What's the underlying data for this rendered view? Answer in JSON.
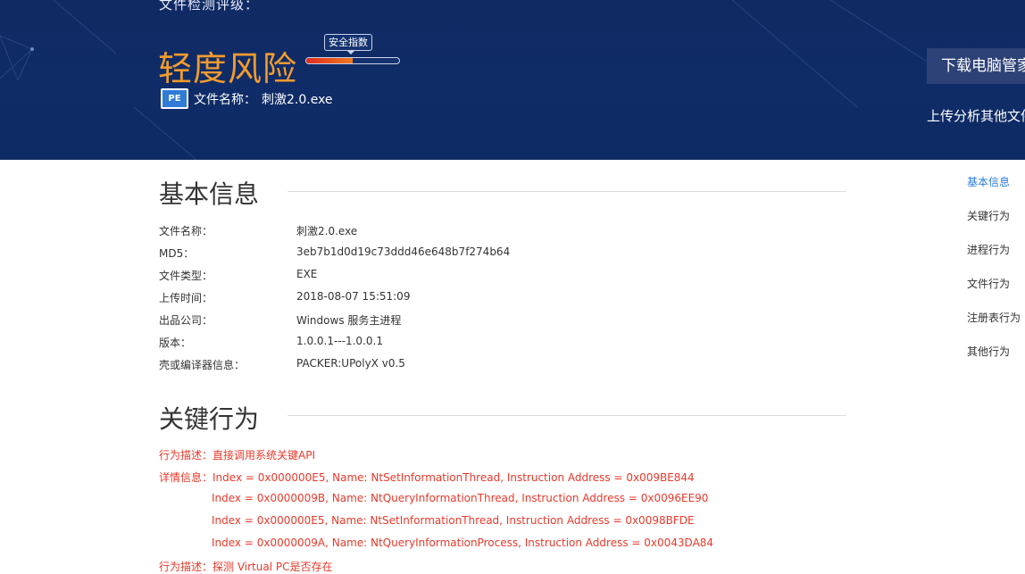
{
  "banner": {
    "grade_label": "文件检测评级：",
    "risk_level": "轻度风险",
    "meter_label": "安全指数",
    "meter_value": 0.5,
    "file_icon_text": "PE",
    "file_name_label": "文件名称：",
    "file_name": "刺激2.0.exe",
    "download_button": "下载电脑管家",
    "upload_link": "上传分析其他文件"
  },
  "basic_info": {
    "title": "基本信息",
    "rows": [
      {
        "label": "文件名称：",
        "value": "刺激2.0.exe"
      },
      {
        "label": "MD5：",
        "value": "3eb7b1d0d19c73ddd46e648b7f274b64"
      },
      {
        "label": "文件类型：",
        "value": "EXE"
      },
      {
        "label": "上传时间：",
        "value": "2018-08-07 15:51:09"
      },
      {
        "label": "出品公司：",
        "value": "Windows 服务主进程"
      },
      {
        "label": "版本：",
        "value": "1.0.0.1---1.0.0.1"
      },
      {
        "label": "壳或编译器信息：",
        "value": "PACKER:UPolyX v0.5"
      }
    ]
  },
  "key_behavior": {
    "title": "关键行为",
    "entries": [
      {
        "desc_label": "行为描述：",
        "desc": "直接调用系统关键API"
      },
      {
        "detail_label": "详情信息：",
        "details": [
          "Index = 0x000000E5, Name: NtSetInformationThread, Instruction Address = 0x009BE844",
          "Index = 0x0000009B, Name: NtQueryInformationThread, Instruction Address = 0x0096EE90",
          "Index = 0x000000E5, Name: NtSetInformationThread, Instruction Address = 0x0098BFDE",
          "Index = 0x0000009A, Name: NtQueryInformationProcess, Instruction Address = 0x0043DA84"
        ]
      },
      {
        "desc_label": "行为描述：",
        "desc": "探测 Virtual PC是否存在"
      }
    ]
  },
  "side_nav": {
    "items": [
      "基本信息",
      "关键行为",
      "进程行为",
      "文件行为",
      "注册表行为",
      "其他行为"
    ],
    "active": "基本信息"
  },
  "colors": {
    "banner_bg": "#102a63",
    "risk_orange": "#f29b2e",
    "alert_red": "#e8392b",
    "nav_active": "#2b7bd5"
  }
}
